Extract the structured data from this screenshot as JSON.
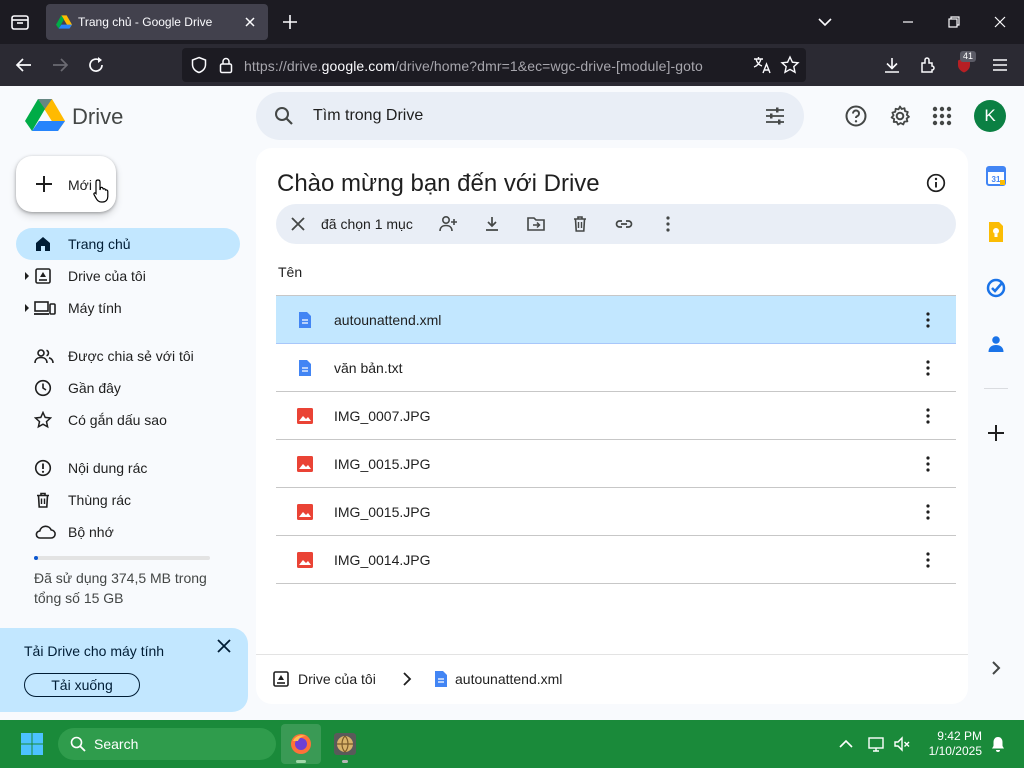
{
  "browser": {
    "tab_title": "Trang chủ - Google Drive",
    "url_prefix": "https://drive.",
    "url_domain": "google.com",
    "url_rest": "/drive/home?dmr=1&ec=wgc-drive-[module]-goto",
    "extension_badge": "41"
  },
  "app": {
    "name": "Drive",
    "avatar_letter": "K",
    "search_placeholder": "Tìm trong Drive"
  },
  "sidebar": {
    "new_label": "Mới",
    "items": [
      {
        "label": "Trang chủ"
      },
      {
        "label": "Drive của tôi"
      },
      {
        "label": "Máy tính"
      },
      {
        "label": "Được chia sẻ với tôi"
      },
      {
        "label": "Gần đây"
      },
      {
        "label": "Có gắn dấu sao"
      },
      {
        "label": "Nội dung rác"
      },
      {
        "label": "Thùng rác"
      },
      {
        "label": "Bộ nhớ"
      }
    ],
    "storage_text": "Đã sử dụng 374,5 MB trong tổng số 15 GB",
    "storage_fraction": 0.024,
    "promo_title": "Tải Drive cho máy tính",
    "promo_button": "Tải xuống"
  },
  "main": {
    "title": "Chào mừng bạn đến với Drive",
    "selection_text": "đã chọn 1 mục",
    "column_header": "Tên",
    "files": [
      {
        "name": "autounattend.xml",
        "type": "doc"
      },
      {
        "name": "văn bản.txt",
        "type": "doc"
      },
      {
        "name": "IMG_0007.JPG",
        "type": "image"
      },
      {
        "name": "IMG_0015.JPG",
        "type": "image"
      },
      {
        "name": "IMG_0015.JPG",
        "type": "image"
      },
      {
        "name": "IMG_0014.JPG",
        "type": "image"
      }
    ],
    "breadcrumb": [
      "Drive của tôi",
      "autounattend.xml"
    ]
  },
  "taskbar": {
    "search_label": "Search",
    "time": "9:42 PM",
    "date": "1/10/2025"
  },
  "colors": {
    "accent": "#0b57d0",
    "selected": "#c2e7ff",
    "taskbar": "#1a8a3a",
    "doc_icon": "#4285f4",
    "image_icon": "#ea4335"
  }
}
